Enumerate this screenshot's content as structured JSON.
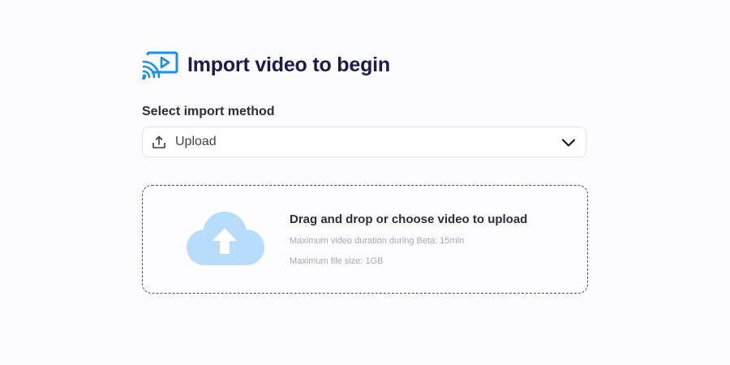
{
  "header": {
    "title": "Import video to begin",
    "logo_icon": "cast-video-icon",
    "accent_color": "#1e8fe8",
    "title_color": "#1e1a4d"
  },
  "import_method": {
    "label": "Select import method",
    "selected": "Upload",
    "icon": "upload-icon"
  },
  "dropzone": {
    "title": "Drag and drop or choose video to upload",
    "duration_note": "Maximum video duration during Beta: 15min",
    "size_note": "Maximum file size: 1GB",
    "icon": "cloud-upload-icon",
    "cloud_color": "#b8dcfb"
  }
}
